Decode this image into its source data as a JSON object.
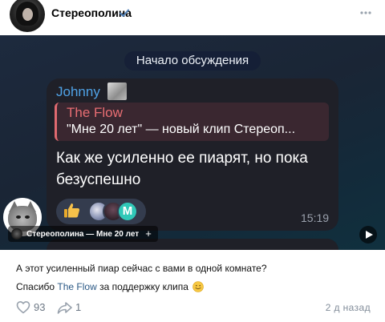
{
  "post": {
    "channel_name": "Стереополина",
    "verified_icon": "verified-check-icon",
    "more_icon": "more-dots-icon"
  },
  "media": {
    "discussion_label": "Начало обсуждения",
    "message": {
      "sender": "Johnny",
      "reply_title": "The Flow",
      "reply_text": "\"Мне 20 лет\" — новый клип Стереоп...",
      "text": "Как же усиленно ее пиарят, но пока безуспешно",
      "reaction_emoji": "thumbs-up-icon",
      "time": "15:19"
    },
    "video_title": "Стереополина — Мне 20 лет",
    "add_icon": "+",
    "play_icon": "play-icon"
  },
  "text": {
    "line1": "А этот усиленный пиар сейчас с вами в одной комнате?",
    "line2_prefix": "Спасибо ",
    "line2_mention": "The Flow",
    "line2_suffix": " за поддержку клипа",
    "emoji": "smiling-face-icon"
  },
  "footer": {
    "likes": "93",
    "shares": "1",
    "date": "2 д назад"
  },
  "colors": {
    "accent_link": "#2a5885",
    "sender_blue": "#4fa2e6",
    "reply_red": "#e86e73",
    "meta_gray": "#818c99"
  }
}
